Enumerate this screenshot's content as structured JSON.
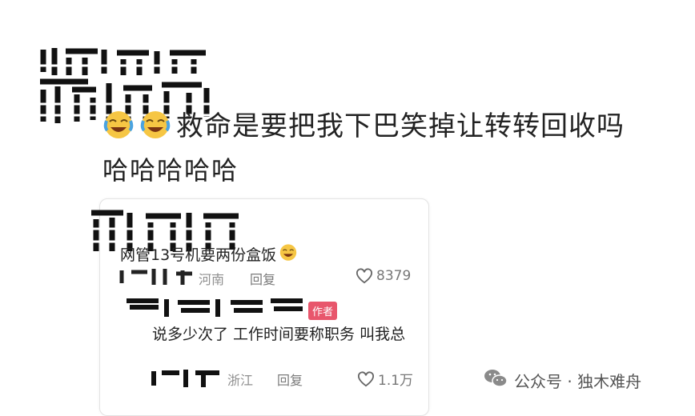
{
  "post": {
    "line1": "救命是要把我下巴笑掉让转转回收吗",
    "line2": "哈哈哈哈哈",
    "redacted_name": "哈哈哈 / 晴晴"
  },
  "reply_card": {
    "comment_text": "网管13号机要两份盒饭",
    "comment_location": "河南",
    "comment_reply_label": "回复",
    "comment_likes": "8379",
    "author_badge": "作者",
    "author_reply": "说多少次了 工作时间要称职务 叫我总",
    "author_location": "浙江",
    "author_reply_label": "回复",
    "author_likes": "1.1万"
  },
  "watermark": {
    "text": "公众号 · 独木难舟",
    "icon": "wechat-icon"
  },
  "colors": {
    "author_badge_bg": "#e8566c",
    "meta_gray": "#8f8f8f"
  }
}
